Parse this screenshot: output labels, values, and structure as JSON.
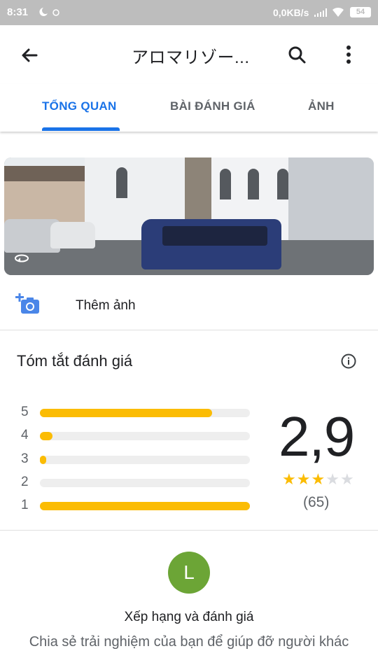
{
  "status_bar": {
    "time": "8:31",
    "network_speed": "0,0KB/s",
    "battery": "54"
  },
  "app_bar": {
    "title": "アロマリゾー...",
    "back_icon": "arrow-back-icon",
    "search_icon": "search-icon",
    "more_icon": "more-vert-icon"
  },
  "tabs": [
    {
      "label": "TỔNG QUAN",
      "active": true
    },
    {
      "label": "BÀI ĐÁNH GIÁ",
      "active": false
    },
    {
      "label": "ẢNH",
      "active": false
    }
  ],
  "add_photo": {
    "label": "Thêm ảnh",
    "icon": "add-photo-camera-icon"
  },
  "review_summary": {
    "title": "Tóm tắt đánh giá",
    "info_icon": "info-icon",
    "distribution": [
      {
        "stars": "5",
        "fraction": 0.82
      },
      {
        "stars": "4",
        "fraction": 0.06
      },
      {
        "stars": "3",
        "fraction": 0.03
      },
      {
        "stars": "2",
        "fraction": 0.0
      },
      {
        "stars": "1",
        "fraction": 1.0
      }
    ],
    "average": "2,9",
    "star_rating": 2.9,
    "review_count": "(65)"
  },
  "rate": {
    "avatar_letter": "L",
    "avatar_color": "#6ca536",
    "title": "Xếp hạng và đánh giá",
    "subtitle": "Chia sẻ trải nghiệm của bạn để giúp đỡ người khác"
  },
  "colors": {
    "accent": "#1a73e8",
    "star": "#fbbc04",
    "track": "#eeeeee"
  }
}
